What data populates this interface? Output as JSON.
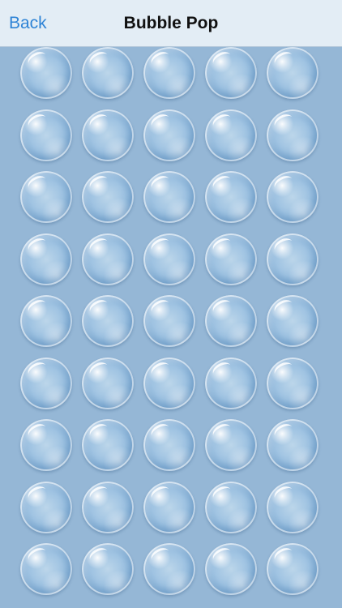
{
  "nav": {
    "back_label": "Back",
    "title": "Bubble Pop"
  },
  "board": {
    "rows": 9,
    "columns": 5,
    "bubbles": [
      [
        true,
        true,
        true,
        true,
        true
      ],
      [
        true,
        true,
        true,
        true,
        true
      ],
      [
        true,
        true,
        true,
        true,
        true
      ],
      [
        true,
        true,
        true,
        true,
        true
      ],
      [
        true,
        true,
        true,
        true,
        true
      ],
      [
        true,
        true,
        true,
        true,
        true
      ],
      [
        true,
        true,
        true,
        true,
        true
      ],
      [
        true,
        true,
        true,
        true,
        true
      ],
      [
        true,
        true,
        true,
        true,
        true
      ]
    ]
  },
  "colors": {
    "background": "#95b7d6",
    "navbar": "#e3edf5",
    "link": "#2f84d6"
  }
}
